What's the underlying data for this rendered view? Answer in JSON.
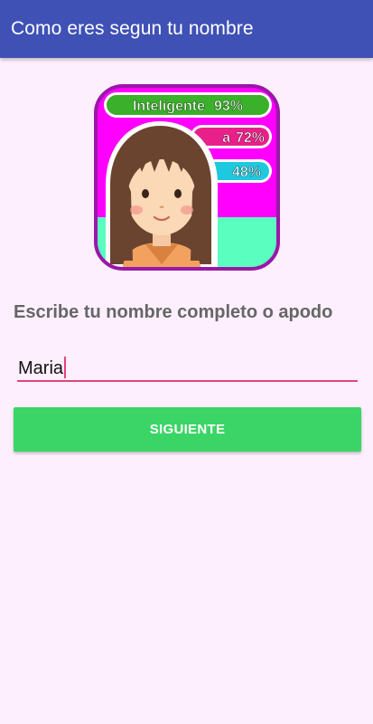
{
  "app_bar": {
    "title": "Como eres segun tu nombre"
  },
  "hero": {
    "stats": [
      {
        "label": "Inteligente",
        "percent": "93%",
        "color": "#3bb02a"
      },
      {
        "label": "a",
        "percent": "72%",
        "color": "#e8208a"
      },
      {
        "label": "",
        "percent": "48%",
        "color": "#1ec9e0"
      }
    ],
    "background_color": "#ff00ff",
    "floor_color": "#5affc0"
  },
  "form": {
    "prompt": "Escribe tu nombre completo o apodo",
    "name_value": "Maria"
  },
  "next_button": {
    "label": "SIGUIENTE"
  },
  "colors": {
    "primary": "#3f51b5",
    "accent": "#e0457b",
    "button": "#3ad566",
    "background": "#fdeffd"
  }
}
